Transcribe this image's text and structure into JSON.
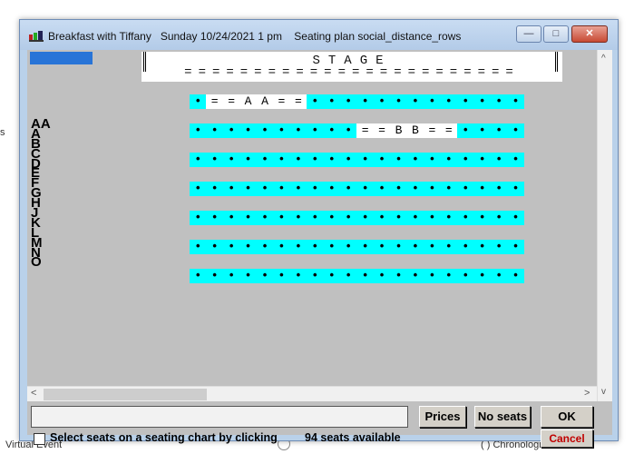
{
  "background": {
    "left_text": "s",
    "bottom_left": "Virtual Event",
    "bottom_right": "( ) Chronological order"
  },
  "window": {
    "title": "Breakfast with Tiffany   Sunday 10/24/2021 1 pm    Seating plan social_distance_rows",
    "minimize_label": "—",
    "maximize_label": "□",
    "close_label": "✕"
  },
  "stage": {
    "label": "STAGE",
    "underline": "========================"
  },
  "row_labels": [
    "AA",
    "A",
    "B",
    "C",
    "D",
    "E",
    "F",
    "G",
    "H",
    "J",
    "K",
    "L",
    "M",
    "N",
    "O"
  ],
  "seat_rows": [
    {
      "seats": [
        "•",
        "=",
        "=",
        "A",
        "A",
        "=",
        "=",
        "•",
        "•",
        "•",
        "•",
        "•",
        "•",
        "•",
        "•",
        "•",
        "•",
        "•",
        "•",
        "•"
      ],
      "taken": [
        false,
        true,
        true,
        true,
        true,
        true,
        true,
        false,
        false,
        false,
        false,
        false,
        false,
        false,
        false,
        false,
        false,
        false,
        false,
        false
      ]
    },
    {
      "seats": [
        "•",
        "•",
        "•",
        "•",
        "•",
        "•",
        "•",
        "•",
        "•",
        "•",
        "=",
        "=",
        "B",
        "B",
        "=",
        "=",
        "•",
        "•",
        "•",
        "•"
      ],
      "taken": [
        false,
        false,
        false,
        false,
        false,
        false,
        false,
        false,
        false,
        false,
        true,
        true,
        true,
        true,
        true,
        true,
        false,
        false,
        false,
        false
      ]
    },
    {
      "seats": [
        "•",
        "•",
        "•",
        "•",
        "•",
        "•",
        "•",
        "•",
        "•",
        "•",
        "•",
        "•",
        "•",
        "•",
        "•",
        "•",
        "•",
        "•",
        "•",
        "•"
      ]
    },
    {
      "seats": [
        "•",
        "•",
        "•",
        "•",
        "•",
        "•",
        "•",
        "•",
        "•",
        "•",
        "•",
        "•",
        "•",
        "•",
        "•",
        "•",
        "•",
        "•",
        "•",
        "•"
      ]
    },
    {
      "seats": [
        "•",
        "•",
        "•",
        "•",
        "•",
        "•",
        "•",
        "•",
        "•",
        "•",
        "•",
        "•",
        "•",
        "•",
        "•",
        "•",
        "•",
        "•",
        "•",
        "•"
      ]
    },
    {
      "seats": [
        "•",
        "•",
        "•",
        "•",
        "•",
        "•",
        "•",
        "•",
        "•",
        "•",
        "•",
        "•",
        "•",
        "•",
        "•",
        "•",
        "•",
        "•",
        "•",
        "•"
      ]
    },
    {
      "seats": [
        "•",
        "•",
        "•",
        "•",
        "•",
        "•",
        "•",
        "•",
        "•",
        "•",
        "•",
        "•",
        "•",
        "•",
        "•",
        "•",
        "•",
        "•",
        "•",
        "•"
      ]
    }
  ],
  "scroll": {
    "left": "<",
    "right": ">",
    "up": "^",
    "down": "v"
  },
  "buttons": {
    "prices": "Prices",
    "no_seats": "No seats",
    "ok": "OK",
    "cancel": "Cancel"
  },
  "checkbox_label": "Select seats on a seating chart by clicking",
  "seats_available": "94 seats available",
  "colors": {
    "available_seat_bg": "#00ffff",
    "taken_seat_bg": "#ffffff",
    "canvas_bg": "#c0c0c0",
    "cancel_text": "#c00000"
  }
}
